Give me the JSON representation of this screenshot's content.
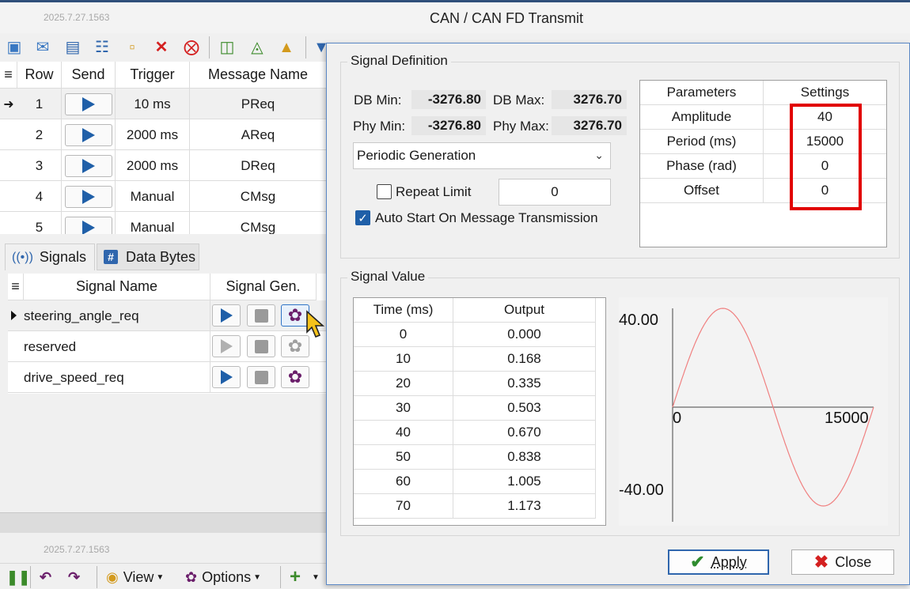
{
  "window": {
    "title": "CAN / CAN FD Transmit",
    "version": "2025.7.27.1563"
  },
  "message_table": {
    "columns": [
      "Row",
      "Send",
      "Trigger",
      "Message Name"
    ],
    "rows": [
      {
        "row": "1",
        "trigger": "10 ms",
        "name": "PReq"
      },
      {
        "row": "2",
        "trigger": "2000 ms",
        "name": "AReq"
      },
      {
        "row": "3",
        "trigger": "2000 ms",
        "name": "DReq"
      },
      {
        "row": "4",
        "trigger": "Manual",
        "name": "CMsg"
      },
      {
        "row": "5",
        "trigger": "Manual",
        "name": "CMsg"
      }
    ]
  },
  "tabs": {
    "signals": "Signals",
    "data_bytes": "Data Bytes"
  },
  "signal_grid": {
    "columns": [
      "Signal Name",
      "Signal Gen."
    ],
    "rows": [
      {
        "name": "steering_angle_req"
      },
      {
        "name": "reserved"
      },
      {
        "name": "drive_speed_req"
      }
    ]
  },
  "bottom_toolbar": {
    "view": "View",
    "options": "Options"
  },
  "dialog": {
    "signal_definition": {
      "title": "Signal Definition",
      "db_min_label": "DB Min:",
      "db_min": "-3276.80",
      "db_max_label": "DB Max:",
      "db_max": "3276.70",
      "phy_min_label": "Phy Min:",
      "phy_min": "-3276.80",
      "phy_max_label": "Phy Max:",
      "phy_max": "3276.70",
      "generation_mode": "Periodic Generation",
      "repeat_limit_label": "Repeat Limit",
      "repeat_limit_value": "0",
      "auto_start_label": "Auto Start On Message Transmission"
    },
    "parameters": {
      "columns": [
        "Parameters",
        "Settings"
      ],
      "rows": [
        {
          "param": "Amplitude",
          "value": "40"
        },
        {
          "param": "Period (ms)",
          "value": "15000"
        },
        {
          "param": "Phase (rad)",
          "value": "0"
        },
        {
          "param": "Offset",
          "value": "0"
        }
      ]
    },
    "signal_value": {
      "title": "Signal Value",
      "columns": [
        "Time (ms)",
        "Output"
      ],
      "rows": [
        {
          "t": "0",
          "out": "0.000"
        },
        {
          "t": "10",
          "out": "0.168"
        },
        {
          "t": "20",
          "out": "0.335"
        },
        {
          "t": "30",
          "out": "0.503"
        },
        {
          "t": "40",
          "out": "0.670"
        },
        {
          "t": "50",
          "out": "0.838"
        },
        {
          "t": "60",
          "out": "1.005"
        },
        {
          "t": "70",
          "out": "1.173"
        }
      ]
    },
    "buttons": {
      "apply": "Apply",
      "close": "Close"
    }
  },
  "chart_data": {
    "type": "line",
    "y_max_label": "40.00",
    "y_min_label": "-40.00",
    "x_origin_label": "0",
    "x_end_label": "15000",
    "ylim": [
      -40,
      40
    ],
    "xlim": [
      0,
      15000
    ],
    "amplitude": 40,
    "period": 15000,
    "line_color": "#f08080"
  }
}
